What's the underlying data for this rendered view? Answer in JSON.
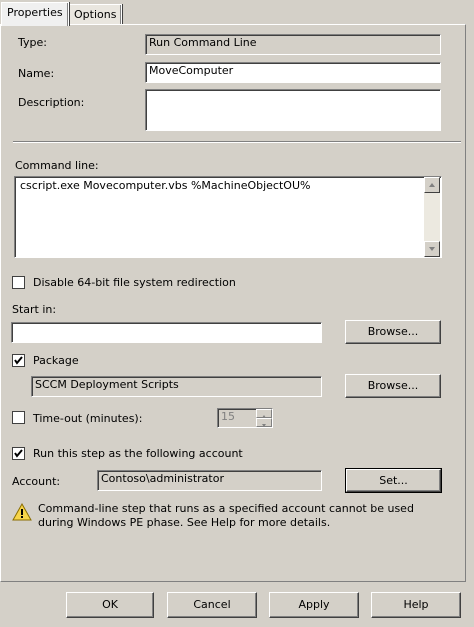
{
  "tabs": [
    "Properties",
    "Options"
  ],
  "type": {
    "label": "Type:",
    "value": "Run Command Line"
  },
  "name": {
    "label": "Name:",
    "value": "MoveComputer"
  },
  "description": {
    "label": "Description:",
    "value": ""
  },
  "command_line": {
    "label": "Command line:",
    "value": "cscript.exe Movecomputer.vbs %MachineObjectOU%"
  },
  "disable64": {
    "label": "Disable 64-bit file system redirection",
    "checked": false
  },
  "start_in": {
    "label": "Start in:",
    "value": "",
    "browse_label": "Browse..."
  },
  "package": {
    "label": "Package",
    "checked": true,
    "value": "SCCM Deployment Scripts",
    "browse_label": "Browse..."
  },
  "timeout": {
    "label": "Time-out (minutes):",
    "checked": false,
    "value": "15"
  },
  "run_as": {
    "label": "Run this step as the following account",
    "checked": true
  },
  "account": {
    "label": "Account:",
    "value": "Contoso\\administrator",
    "set_label": "Set..."
  },
  "warning": {
    "text": "Command-line step that runs as a specified account cannot be used during Windows PE phase. See Help for more details.",
    "icon": "warning-icon"
  },
  "buttons": {
    "ok": "OK",
    "cancel": "Cancel",
    "apply": "Apply",
    "help": "Help"
  },
  "colors": {
    "dialog_bg": "#d4d0c8",
    "warning_yellow": "#f7d54a"
  }
}
